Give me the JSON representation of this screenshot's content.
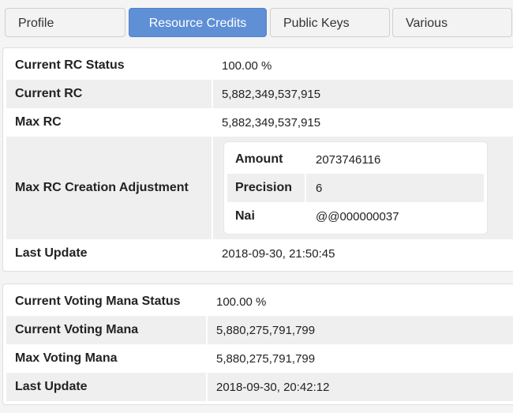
{
  "tabs": [
    {
      "label": "Profile"
    },
    {
      "label": "Resource Credits"
    },
    {
      "label": "Public Keys"
    },
    {
      "label": "Various"
    }
  ],
  "rc": {
    "status_label": "Current RC Status",
    "status_value": "100.00 %",
    "current_label": "Current RC",
    "current_value": "5,882,349,537,915",
    "max_label": "Max RC",
    "max_value": "5,882,349,537,915",
    "adjustment_label": "Max RC Creation Adjustment",
    "adjustment": {
      "amount_label": "Amount",
      "amount_value": "2073746116",
      "precision_label": "Precision",
      "precision_value": "6",
      "nai_label": "Nai",
      "nai_value": "@@000000037"
    },
    "last_update_label": "Last Update",
    "last_update_value": "2018-09-30, 21:50:45"
  },
  "voting": {
    "status_label": "Current Voting Mana Status",
    "status_value": "100.00 %",
    "current_label": "Current Voting Mana",
    "current_value": "5,880,275,791,799",
    "max_label": "Max Voting Mana",
    "max_value": "5,880,275,791,799",
    "last_update_label": "Last Update",
    "last_update_value": "2018-09-30, 20:42:12"
  }
}
